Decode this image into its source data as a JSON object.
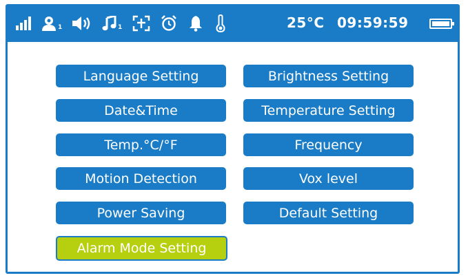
{
  "status_bar": {
    "icons": [
      {
        "name": "signal-icon"
      },
      {
        "name": "camera-user-icon",
        "subscript": "1"
      },
      {
        "name": "volume-icon"
      },
      {
        "name": "music-icon",
        "subscript": "1"
      },
      {
        "name": "zoom-icon"
      },
      {
        "name": "alarm-clock-icon"
      },
      {
        "name": "bell-icon"
      },
      {
        "name": "thermometer-icon"
      }
    ],
    "temperature": "25°C",
    "time": "09:59:59",
    "battery_icon": "battery-icon"
  },
  "menu": {
    "items": [
      {
        "label": "Language Setting",
        "selected": false
      },
      {
        "label": "Brightness Setting",
        "selected": false
      },
      {
        "label": "Date&Time",
        "selected": false
      },
      {
        "label": "Temperature Setting",
        "selected": false
      },
      {
        "label": "Temp.°C/°F",
        "selected": false
      },
      {
        "label": "Frequency",
        "selected": false
      },
      {
        "label": "Motion Detection",
        "selected": false
      },
      {
        "label": "Vox level",
        "selected": false
      },
      {
        "label": "Power Saving",
        "selected": false
      },
      {
        "label": "Default Setting",
        "selected": false
      },
      {
        "label": "Alarm Mode Setting",
        "selected": true
      }
    ]
  },
  "colors": {
    "primary": "#1a7cc6",
    "selected": "#b6cf0e",
    "text": "#ffffff"
  }
}
